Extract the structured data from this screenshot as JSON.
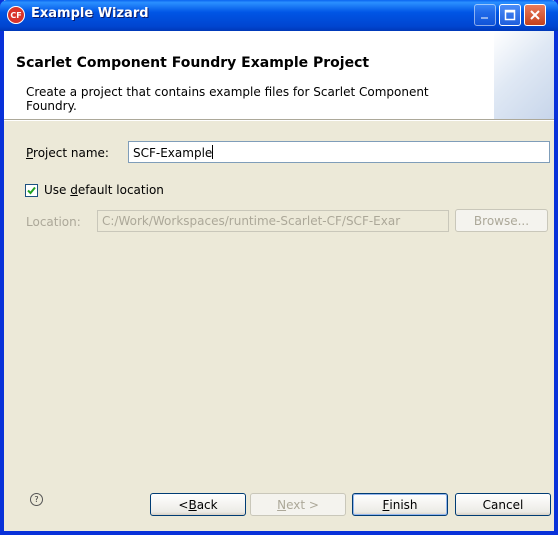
{
  "window": {
    "title": "Example Wizard",
    "app_icon_text": "CF"
  },
  "banner": {
    "title": "Scarlet Component Foundry Example Project",
    "description": "Create a project that contains example files for Scarlet Component Foundry."
  },
  "form": {
    "project_name": {
      "label_pre": "",
      "label_mnemonic": "P",
      "label_post": "roject name:",
      "value": "SCF-Example"
    },
    "use_default_location": {
      "label_pre": "Use ",
      "label_mnemonic": "d",
      "label_post": "efault location",
      "checked": true
    },
    "location": {
      "label": "Location:",
      "value": "C:/Work/Workspaces/runtime-Scarlet-CF/SCF-Exar"
    },
    "browse_label": "Browse..."
  },
  "buttons": {
    "back": {
      "pre": "< ",
      "mnemonic": "B",
      "post": "ack"
    },
    "next": {
      "pre": "",
      "mnemonic": "N",
      "post": "ext >"
    },
    "finish": {
      "pre": "",
      "mnemonic": "F",
      "post": "inish"
    },
    "cancel": "Cancel"
  },
  "icons": {
    "help": "help-icon",
    "checkmark": "checkmark-icon",
    "minimize": "minimize-icon",
    "maximize": "maximize-icon",
    "close": "close-icon"
  }
}
